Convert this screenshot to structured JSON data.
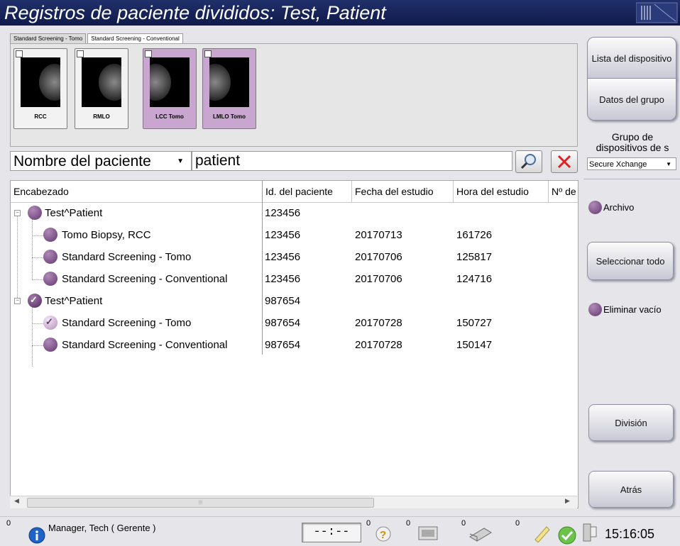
{
  "window": {
    "title": "Registros de paciente divididos: Test, Patient"
  },
  "thumbnails": {
    "tabs": [
      "Standard Screening - Tomo",
      "Standard Screening - Conventional"
    ],
    "items": [
      {
        "label": "RCC",
        "tomo": false
      },
      {
        "label": "RMLO",
        "tomo": false
      },
      {
        "label": "LCC Tomo",
        "tomo": true
      },
      {
        "label": "LMLO Tomo",
        "tomo": true
      }
    ]
  },
  "search": {
    "field_selected": "Nombre del paciente",
    "value": "patient"
  },
  "grid": {
    "columns": [
      "Encabezado",
      "Id. del paciente",
      "Fecha del estudio",
      "Hora del estudio",
      "Nº de"
    ],
    "rows": [
      {
        "level": 0,
        "name": "Test^Patient",
        "id": "123456",
        "date": "",
        "time": "",
        "state": "normal"
      },
      {
        "level": 1,
        "name": "Tomo Biopsy, RCC",
        "id": "123456",
        "date": "20170713",
        "time": "161726",
        "state": "normal"
      },
      {
        "level": 1,
        "name": "Standard Screening - Tomo",
        "id": "123456",
        "date": "20170706",
        "time": "125817",
        "state": "normal"
      },
      {
        "level": 1,
        "name": "Standard Screening - Conventional",
        "id": "123456",
        "date": "20170706",
        "time": "124716",
        "state": "normal"
      },
      {
        "level": 0,
        "name": "Test^Patient",
        "id": "987654",
        "date": "",
        "time": "",
        "state": "dark-check"
      },
      {
        "level": 1,
        "name": "Standard Screening - Tomo",
        "id": "987654",
        "date": "20170728",
        "time": "150727",
        "state": "check"
      },
      {
        "level": 1,
        "name": "Standard Screening - Conventional",
        "id": "987654",
        "date": "20170728",
        "time": "150147",
        "state": "normal"
      }
    ]
  },
  "side": {
    "device_list": "Lista del dispositivo",
    "group_data": "Datos del grupo",
    "device_group_label": "Grupo de dispositivos de s",
    "device_group_value": "Secure Xchange",
    "archive": "Archivo",
    "select_all": "Seleccionar todo",
    "delete_empty": "Eliminar vacío",
    "split": "División",
    "back": "Atrás"
  },
  "status": {
    "count_info": "0",
    "user": "Manager, Tech ( Gerente )",
    "timer": "--:--",
    "count_help": "0",
    "count_transfer": "0",
    "count_print": "0",
    "count_notes": "0",
    "clock": "15:16:05"
  },
  "colors": {
    "title_bg": "#1a2760",
    "tomo_thumb": "#c9a6cf",
    "status_ball": "#7a4f86"
  }
}
